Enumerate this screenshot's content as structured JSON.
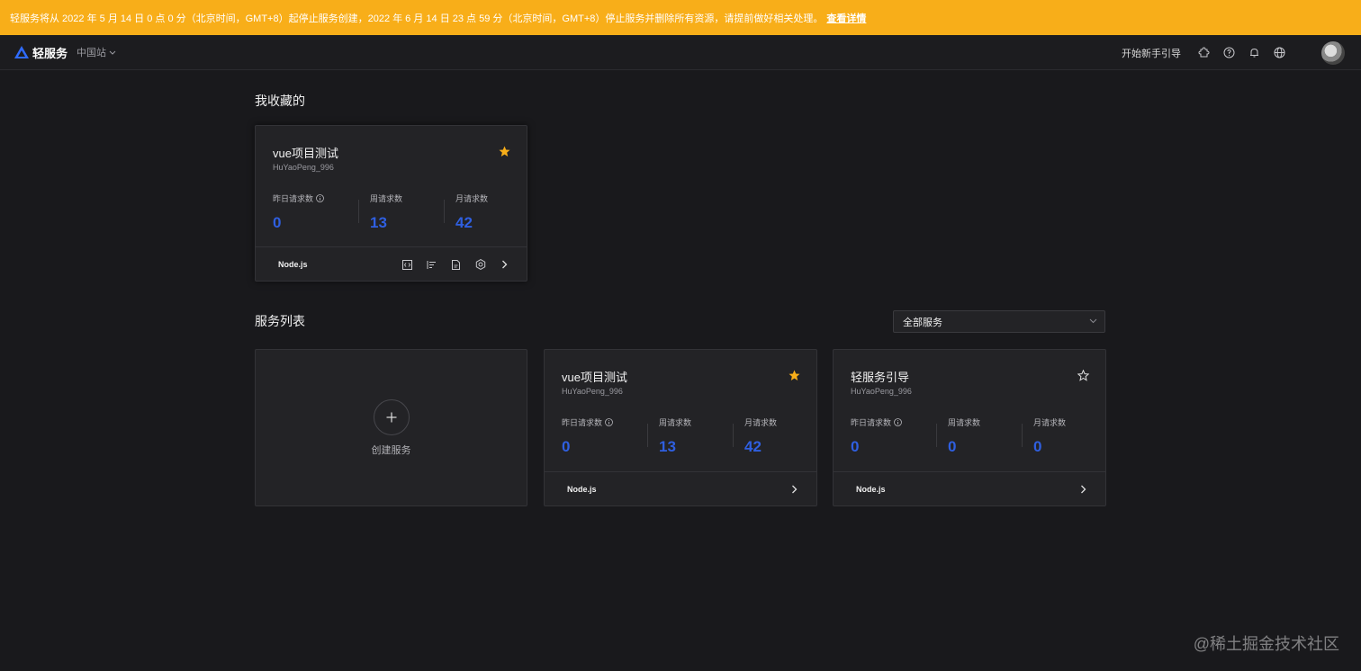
{
  "banner": {
    "text": "轻服务将从 2022 年 5 月 14 日 0 点 0 分（北京时间，GMT+8）起停止服务创建，2022 年 6 月 14 日 23 点 59 分（北京时间，GMT+8）停止服务并删除所有资源，请提前做好相关处理。",
    "link": "查看详情",
    "color": "#f8ae19"
  },
  "topbar": {
    "brand": "轻服务",
    "region": "中国站",
    "guide": "开始新手引导",
    "icons": [
      "plugin-icon",
      "help-icon",
      "bell-icon",
      "globe-icon"
    ]
  },
  "favorites": {
    "title": "我收藏的",
    "card": {
      "name": "vue项目测试",
      "owner": "HuYaoPeng_996",
      "starred": true,
      "stats": [
        {
          "label": "昨日请求数",
          "value": "0",
          "info": true
        },
        {
          "label": "周请求数",
          "value": "13"
        },
        {
          "label": "月请求数",
          "value": "42"
        }
      ],
      "runtime": "Node.js",
      "actions": [
        "code-icon",
        "list-icon",
        "doc-icon",
        "settings-icon",
        "chevron-right-icon"
      ]
    }
  },
  "services": {
    "title": "服务列表",
    "filter": "全部服务",
    "create_label": "创建服务",
    "cards": [
      {
        "name": "vue项目测试",
        "owner": "HuYaoPeng_996",
        "starred": true,
        "stats": [
          {
            "label": "昨日请求数",
            "value": "0"
          },
          {
            "label": "周请求数",
            "value": "13"
          },
          {
            "label": "月请求数",
            "value": "42"
          }
        ],
        "runtime": "Node.js"
      },
      {
        "name": "轻服务引导",
        "owner": "HuYaoPeng_996",
        "starred": false,
        "stats": [
          {
            "label": "昨日请求数",
            "value": "0"
          },
          {
            "label": "周请求数",
            "value": "0"
          },
          {
            "label": "月请求数",
            "value": "0"
          }
        ],
        "runtime": "Node.js"
      }
    ]
  },
  "watermark": "@稀土掘金技术社区",
  "colors": {
    "accent": "#2f5fe0",
    "star": "#f8ae19",
    "background": "#19191c"
  }
}
